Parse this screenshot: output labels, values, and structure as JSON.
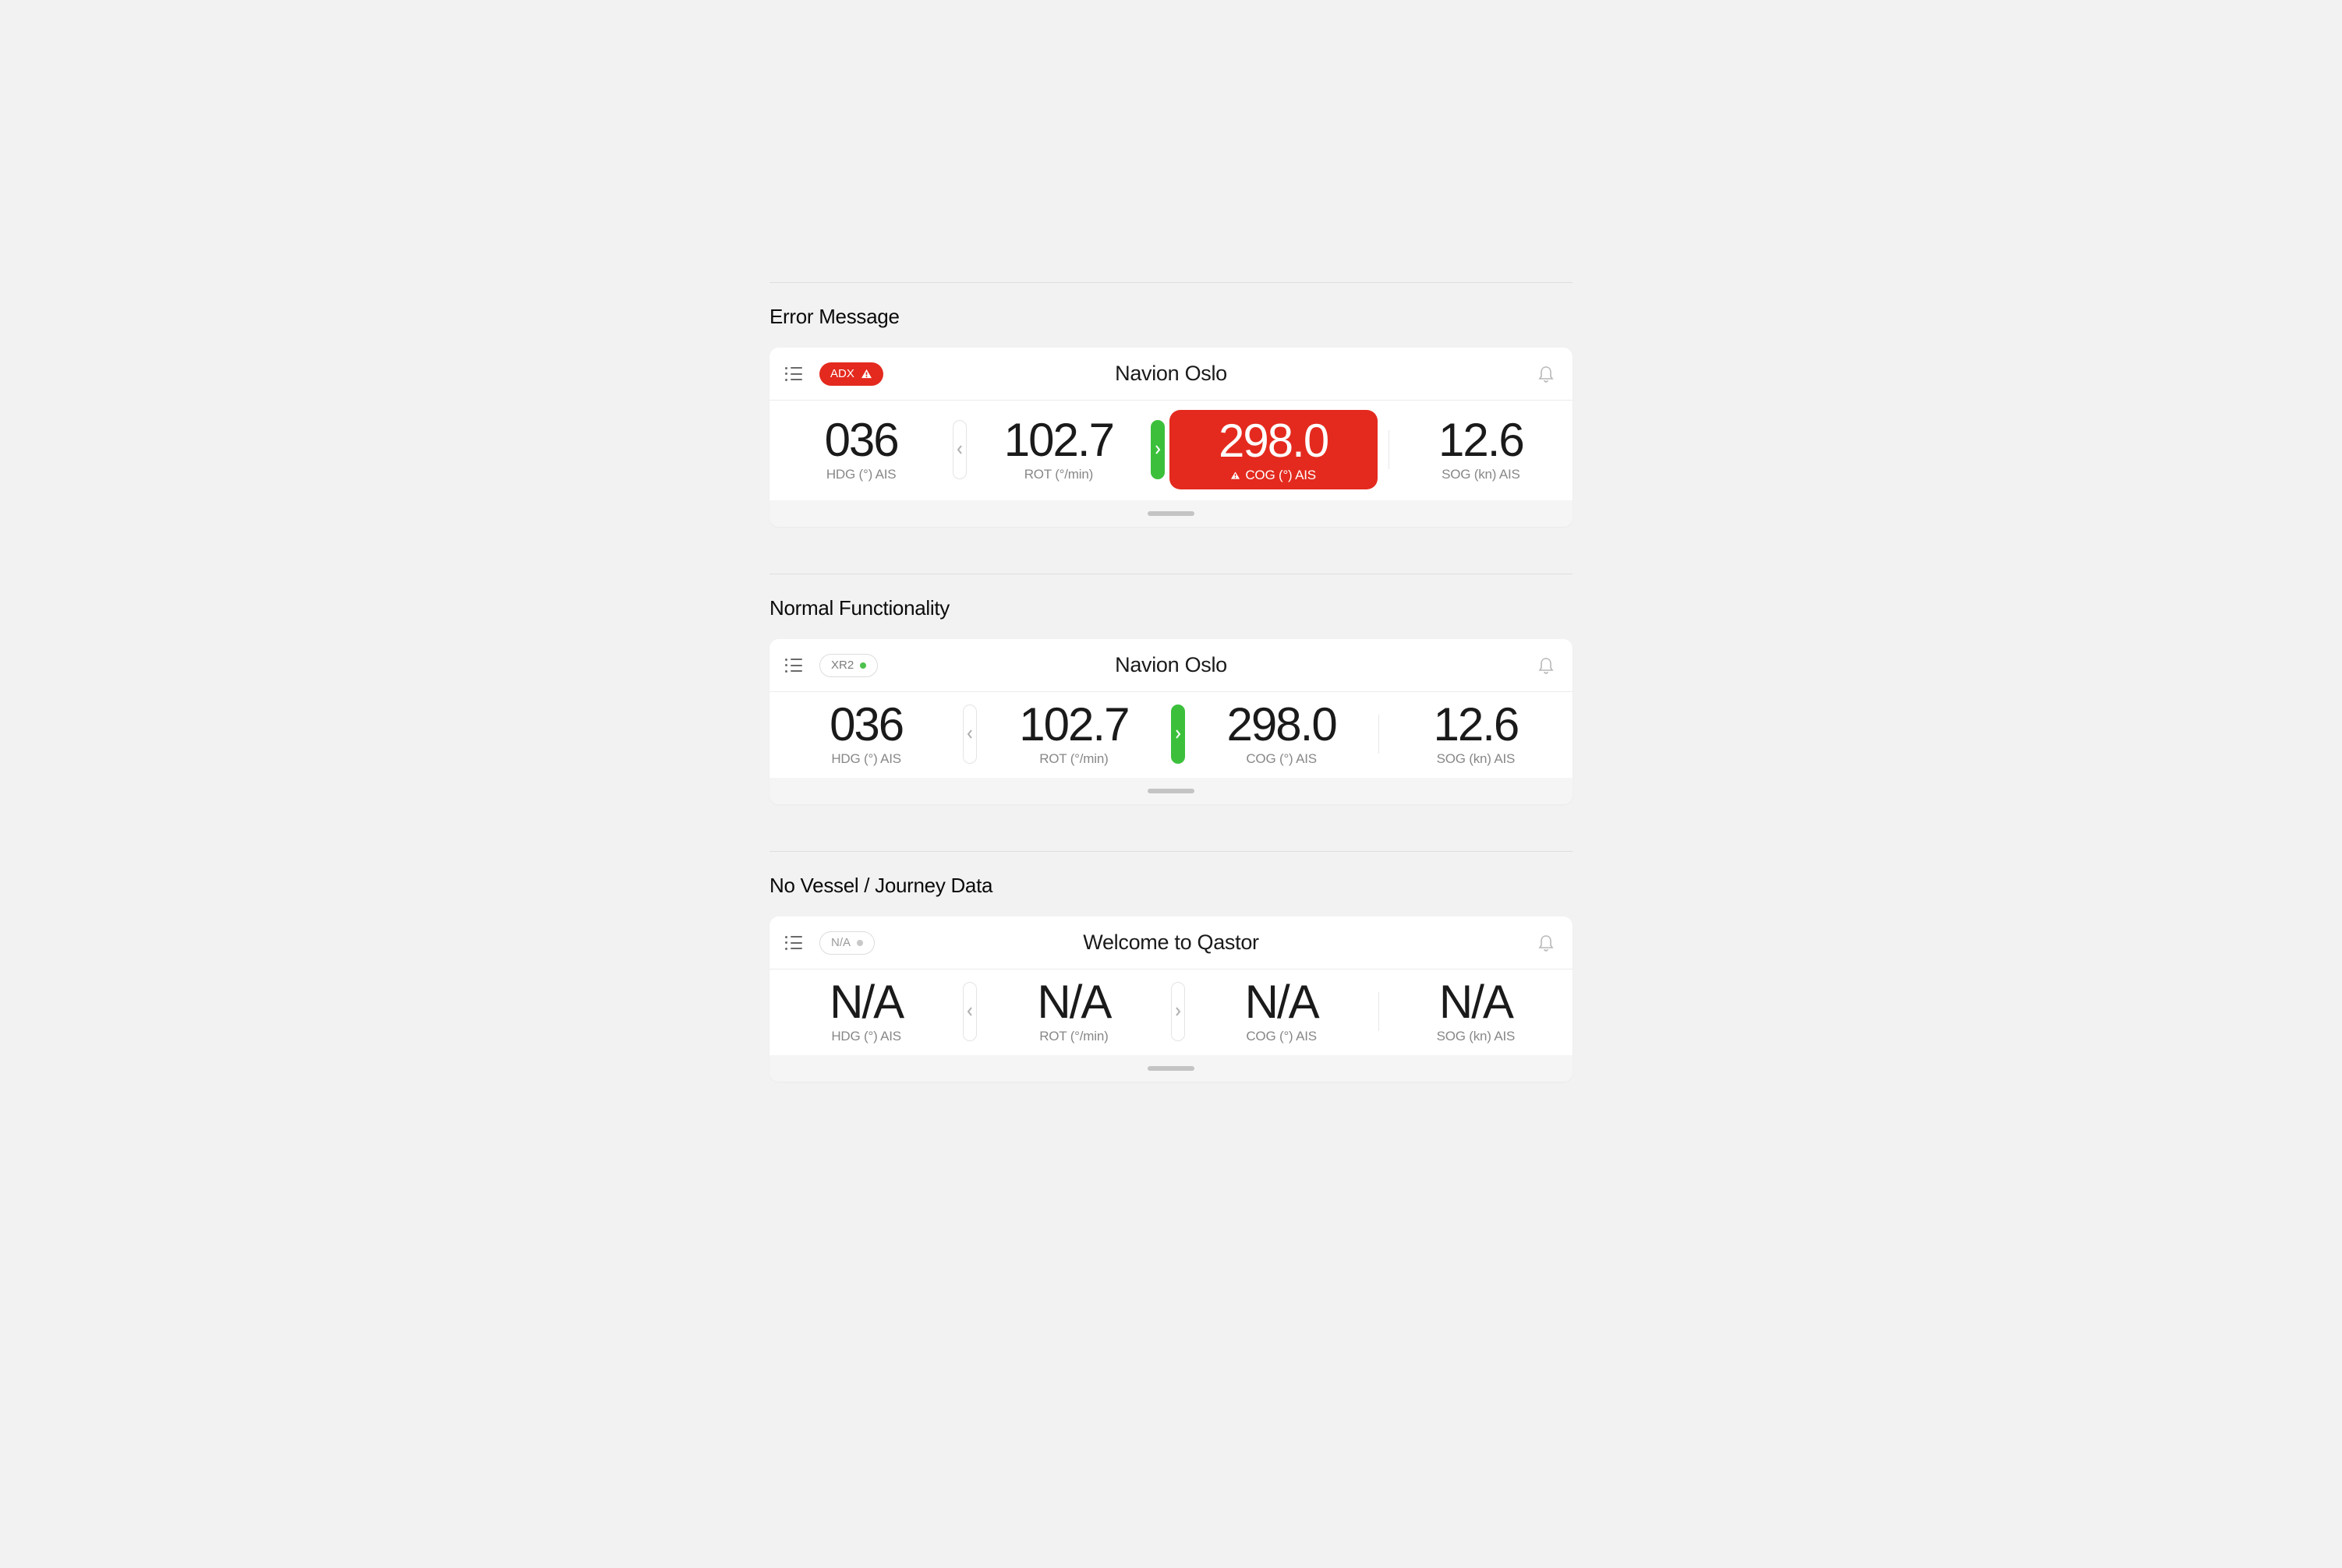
{
  "sections": {
    "error": {
      "title": "Error Message",
      "badge_text": "ADX",
      "panel_title": "Navion Oslo",
      "metrics": {
        "hdg": {
          "value": "036",
          "label": "HDG (°) AIS"
        },
        "rot": {
          "value": "102.7",
          "label": "ROT (°/min)"
        },
        "cog": {
          "value": "298.0",
          "label": "COG (°) AIS"
        },
        "sog": {
          "value": "12.6",
          "label": "SOG (kn) AIS"
        }
      }
    },
    "normal": {
      "title": "Normal Functionality",
      "badge_text": "XR2",
      "panel_title": "Navion Oslo",
      "metrics": {
        "hdg": {
          "value": "036",
          "label": "HDG (°) AIS"
        },
        "rot": {
          "value": "102.7",
          "label": "ROT (°/min)"
        },
        "cog": {
          "value": "298.0",
          "label": "COG (°) AIS"
        },
        "sog": {
          "value": "12.6",
          "label": "SOG (kn) AIS"
        }
      }
    },
    "na": {
      "title": "No Vessel / Journey Data",
      "badge_text": "N/A",
      "panel_title": "Welcome to Qastor",
      "metrics": {
        "hdg": {
          "value": "N/A",
          "label": "HDG (°) AIS"
        },
        "rot": {
          "value": "N/A",
          "label": "ROT (°/min)"
        },
        "cog": {
          "value": "N/A",
          "label": "COG (°) AIS"
        },
        "sog": {
          "value": "N/A",
          "label": "SOG (kn) AIS"
        }
      }
    }
  },
  "colors": {
    "error": "#e42a1e",
    "success": "#3cc03c"
  }
}
